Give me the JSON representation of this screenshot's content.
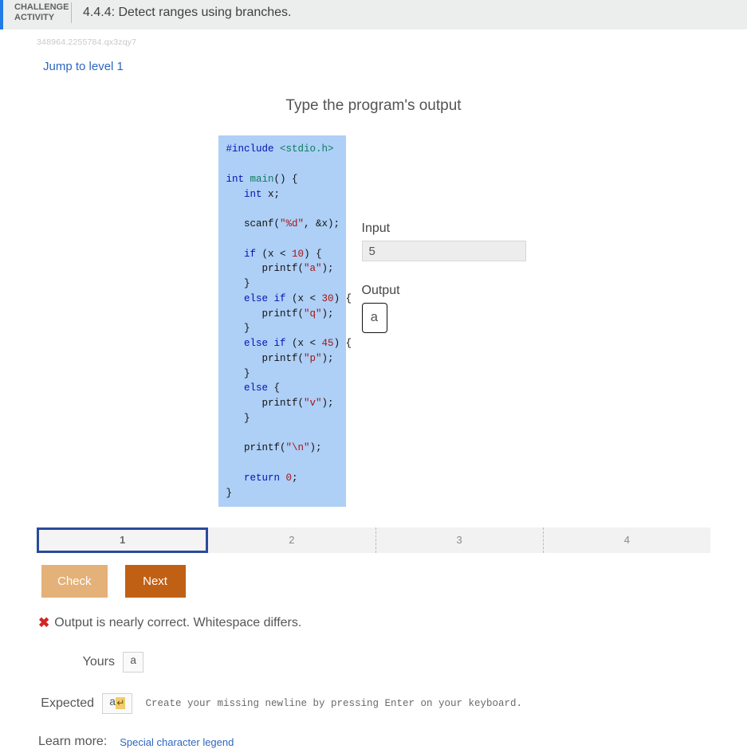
{
  "header": {
    "label_line1": "CHALLENGE",
    "label_line2": "ACTIVITY",
    "title": "4.4.4: Detect ranges using branches."
  },
  "tracking_id": "348964.2255784.qx3zqy7",
  "jump_link": "Jump to level 1",
  "instruction": "Type the program's output",
  "code_tokens": [
    {
      "t": "#include ",
      "c": "kw-blue"
    },
    {
      "t": "<stdio.h>",
      "c": "kw-green"
    },
    {
      "t": "\n\n"
    },
    {
      "t": "int ",
      "c": "kw-blue"
    },
    {
      "t": "main",
      "c": "kw-green"
    },
    {
      "t": "() {\n   "
    },
    {
      "t": "int",
      "c": "kw-blue"
    },
    {
      "t": " x;\n\n   scanf("
    },
    {
      "t": "\"%d\"",
      "c": "str"
    },
    {
      "t": ", &x);\n\n   "
    },
    {
      "t": "if",
      "c": "kw-blue"
    },
    {
      "t": " (x < "
    },
    {
      "t": "10",
      "c": "num"
    },
    {
      "t": ") {\n      printf("
    },
    {
      "t": "\"a\"",
      "c": "str"
    },
    {
      "t": ");\n   }\n   "
    },
    {
      "t": "else if",
      "c": "kw-blue"
    },
    {
      "t": " (x < "
    },
    {
      "t": "30",
      "c": "num"
    },
    {
      "t": ") {\n      printf("
    },
    {
      "t": "\"q\"",
      "c": "str"
    },
    {
      "t": ");\n   }\n   "
    },
    {
      "t": "else if",
      "c": "kw-blue"
    },
    {
      "t": " (x < "
    },
    {
      "t": "45",
      "c": "num"
    },
    {
      "t": ") {\n      printf("
    },
    {
      "t": "\"p\"",
      "c": "str"
    },
    {
      "t": ");\n   }\n   "
    },
    {
      "t": "else",
      "c": "kw-blue"
    },
    {
      "t": " {\n      printf("
    },
    {
      "t": "\"v\"",
      "c": "str"
    },
    {
      "t": ");\n   }\n\n   printf("
    },
    {
      "t": "\"\\n\"",
      "c": "str"
    },
    {
      "t": ");\n\n   "
    },
    {
      "t": "return ",
      "c": "kw-blue"
    },
    {
      "t": "0",
      "c": "num"
    },
    {
      "t": ";\n}"
    }
  ],
  "io": {
    "input_label": "Input",
    "input_value": "5",
    "output_label": "Output",
    "output_value": "a"
  },
  "levels": [
    "1",
    "2",
    "3",
    "4"
  ],
  "active_level_index": 0,
  "buttons": {
    "check": "Check",
    "next": "Next"
  },
  "feedback": {
    "message": "Output is nearly correct. Whitespace differs.",
    "yours_label": "Yours",
    "yours_value": "a",
    "expected_label": "Expected",
    "expected_value": "a",
    "expected_has_newline": true,
    "hint": "Create your missing newline by pressing Enter on your keyboard.",
    "learn_label": "Learn more:",
    "learn_link": "Special character legend"
  }
}
